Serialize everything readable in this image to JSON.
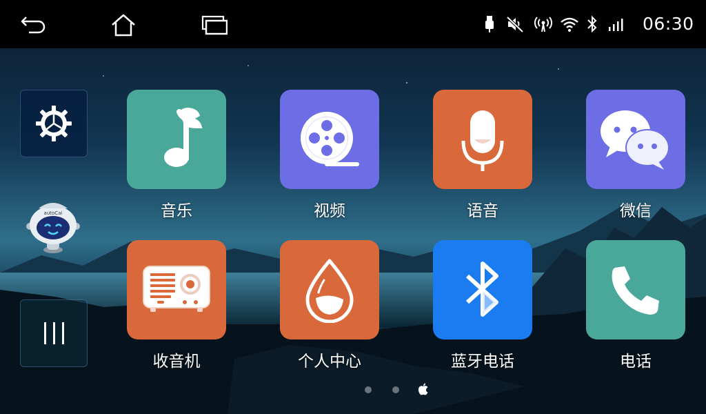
{
  "status_bar": {
    "time": "06:30",
    "icons": [
      "usb-icon",
      "volume-muted-icon",
      "hotspot-icon",
      "wifi-icon",
      "bluetooth-icon",
      "cellular-signal-icon"
    ]
  },
  "nav_bar": {
    "icons": [
      "back-icon",
      "home-icon",
      "recent-apps-icon"
    ]
  },
  "side_dock": {
    "icons": [
      "gear-icon",
      "assistant-robot-icon",
      "app-drawer-icon"
    ],
    "robot_badge": "autoCai"
  },
  "apps": [
    {
      "label": "音乐",
      "icon": "music-note-icon",
      "color": "#4aa89a"
    },
    {
      "label": "视频",
      "icon": "film-reel-icon",
      "color": "#6d6ee6"
    },
    {
      "label": "语音",
      "icon": "microphone-icon",
      "color": "#d9693a"
    },
    {
      "label": "微信",
      "icon": "chat-bubbles-icon",
      "color": "#6d6ee6"
    },
    {
      "label": "收音机",
      "icon": "radio-icon",
      "color": "#d9693a"
    },
    {
      "label": "个人中心",
      "icon": "water-drop-icon",
      "color": "#d9693a"
    },
    {
      "label": "蓝牙电话",
      "icon": "bluetooth-icon",
      "color": "#1a7cf0"
    },
    {
      "label": "电话",
      "icon": "phone-handset-icon",
      "color": "#4aa89a"
    }
  ],
  "pager": {
    "pages": 3,
    "current_page_icon": "apple-carplay-icon"
  }
}
